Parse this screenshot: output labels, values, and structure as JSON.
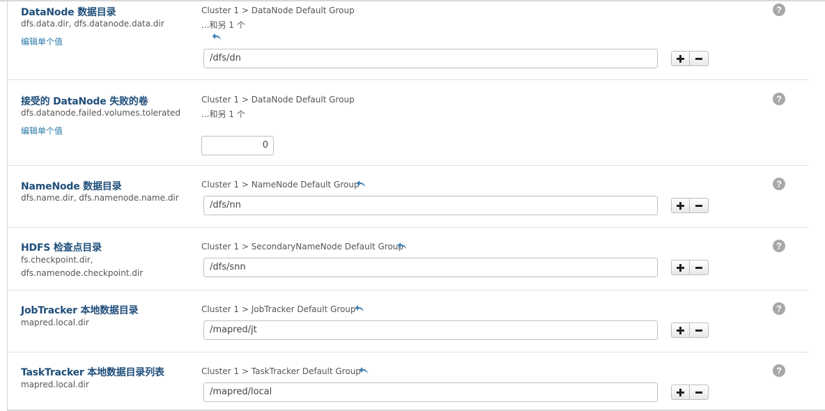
{
  "rows": [
    {
      "title": "DataNode 数据目录",
      "props": [
        "dfs.data.dir, dfs.datanode.data.dir"
      ],
      "edit_link": "编辑单个值",
      "scope": "Cluster 1 > DataNode Default Group",
      "more": "...和另 1 个",
      "value": "/dfs/dn"
    },
    {
      "title": "接受的 DataNode 失败的卷",
      "props": [
        "dfs.datanode.failed.volumes.tolerated"
      ],
      "edit_link": "编辑单个值",
      "scope": "Cluster 1 > DataNode Default Group",
      "more": "...和另 1 个",
      "value": "0"
    },
    {
      "title": "NameNode 数据目录",
      "props": [
        "dfs.name.dir, dfs.namenode.name.dir"
      ],
      "scope": "Cluster 1 > NameNode Default Group",
      "value": "/dfs/nn"
    },
    {
      "title": "HDFS 检查点目录",
      "props": [
        "fs.checkpoint.dir,",
        "dfs.namenode.checkpoint.dir"
      ],
      "scope": "Cluster 1 > SecondaryNameNode Default Group",
      "value": "/dfs/snn"
    },
    {
      "title": "JobTracker 本地数据目录",
      "props": [
        "mapred.local.dir"
      ],
      "scope": "Cluster 1 > JobTracker Default Group",
      "value": "/mapred/jt"
    },
    {
      "title": "TaskTracker 本地数据目录列表",
      "props": [
        "mapred.local.dir"
      ],
      "scope": "Cluster 1 > TaskTracker Default Group",
      "value": "/mapred/local"
    }
  ],
  "icons": {
    "undo": "undo-arrow-icon",
    "help": "question-circle-icon",
    "plus": "plus-icon",
    "minus": "minus-icon"
  },
  "colors": {
    "title": "#1f4e7a",
    "link": "#2a7aa8",
    "undo": "#3c7fb1",
    "help": "#a8a8a8"
  }
}
